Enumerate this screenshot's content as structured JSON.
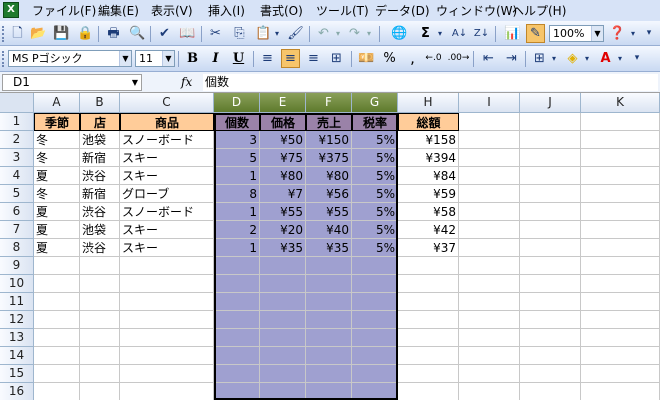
{
  "menubar": {
    "items": [
      "ファイル(F)",
      "編集(E)",
      "表示(V)",
      "挿入(I)",
      "書式(O)",
      "ツール(T)",
      "データ(D)",
      "ウィンドウ(W)",
      "ヘルプ(H)"
    ]
  },
  "toolbar": {
    "zoom": "100%",
    "font_name": "MS Pゴシック",
    "font_size": "11"
  },
  "formula_bar": {
    "name_box": "D1",
    "fx_label": "fx",
    "content": "個数"
  },
  "sheet": {
    "columns": [
      "A",
      "B",
      "C",
      "D",
      "E",
      "F",
      "G",
      "H",
      "I",
      "J",
      "K"
    ],
    "selected_columns": [
      "D",
      "E",
      "F",
      "G"
    ],
    "row_numbers": [
      "1",
      "2",
      "3",
      "4",
      "5",
      "6",
      "7",
      "8",
      "9",
      "10",
      "11",
      "12",
      "13",
      "14",
      "15",
      "16"
    ],
    "header_row": [
      "季節",
      "店",
      "商品",
      "個数",
      "価格",
      "売上",
      "税率",
      "総額"
    ],
    "rows": [
      [
        "冬",
        "池袋",
        "スノーボード",
        "3",
        "¥50",
        "¥150",
        "5%",
        "¥158"
      ],
      [
        "冬",
        "新宿",
        "スキー",
        "5",
        "¥75",
        "¥375",
        "5%",
        "¥394"
      ],
      [
        "夏",
        "渋谷",
        "スキー",
        "1",
        "¥80",
        "¥80",
        "5%",
        "¥84"
      ],
      [
        "冬",
        "新宿",
        "グローブ",
        "8",
        "¥7",
        "¥56",
        "5%",
        "¥59"
      ],
      [
        "夏",
        "渋谷",
        "スノーボード",
        "1",
        "¥55",
        "¥55",
        "5%",
        "¥58"
      ],
      [
        "夏",
        "池袋",
        "スキー",
        "2",
        "¥20",
        "¥40",
        "5%",
        "¥42"
      ],
      [
        "夏",
        "渋谷",
        "スキー",
        "1",
        "¥35",
        "¥35",
        "5%",
        "¥37"
      ]
    ],
    "colors": {
      "orange_header": "#ffcc99",
      "selected_header": "#9a82a8",
      "selection_fill": "#9fa0d0",
      "selected_column_header": "#6b8436"
    }
  }
}
